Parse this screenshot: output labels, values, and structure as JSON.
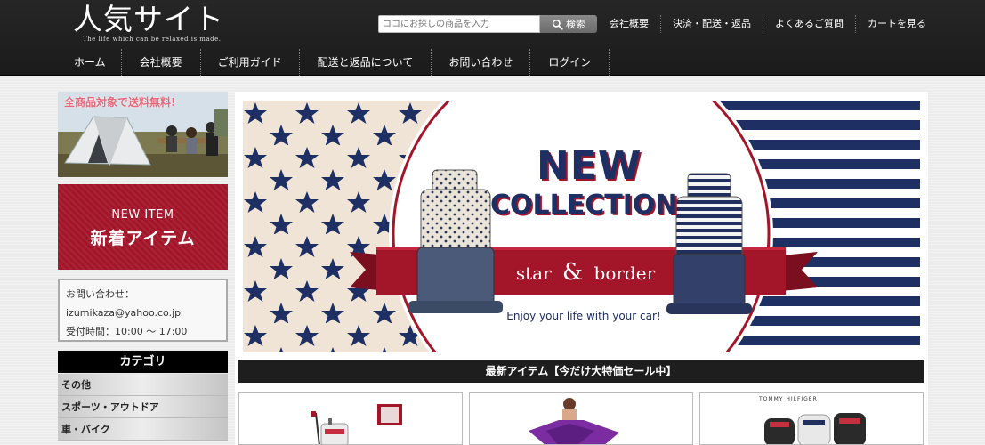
{
  "header": {
    "logo_title": "人気サイト",
    "logo_subtitle": "The life which can be relaxed is made.",
    "search": {
      "placeholder": "ココにお探しの商品を入力",
      "button_label": "検索"
    },
    "top_links": [
      "会社概要",
      "決済・配送・返品",
      "よくあるご質問",
      "カートを見る"
    ],
    "nav": [
      "ホーム",
      "会社概要",
      "ご利用ガイド",
      "配送と返品について",
      "お問い合わせ",
      "ログイン"
    ]
  },
  "sidebar": {
    "camp_banner_text": "全商品対象で送料無料!",
    "new_item_banner": {
      "en": "NEW ITEM",
      "ja": "新着アイテム"
    },
    "contact": {
      "label": "お問い合わせ：",
      "email": "izumikaza@yahoo.co.jp",
      "hours": "受付時間：10:00 〜 17:00"
    },
    "category_title": "カテゴリ",
    "categories": [
      "その他",
      "スポーツ・アウトドア",
      "車・バイク"
    ]
  },
  "hero": {
    "title_line1": "NEW",
    "title_line2": "COLLECTION",
    "ribbon_left": "star",
    "ribbon_amp": "&",
    "ribbon_right": "border",
    "tagline": "Enjoy your life with your car!"
  },
  "main": {
    "section_title": "最新アイテム【今だけ大特価セール中】",
    "product3_brand": "TOMMY HILFIGER"
  },
  "colors": {
    "header_bg": "#1f1f1f",
    "accent_red": "#a3162a",
    "navy": "#1d2f63",
    "pink_text": "#e8657a"
  }
}
